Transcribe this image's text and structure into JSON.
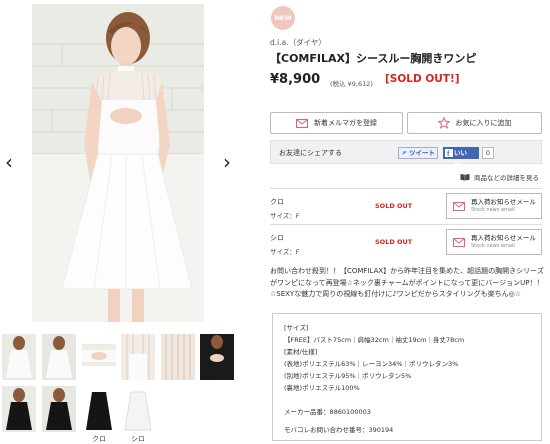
{
  "gallery": {
    "prev_arrow": "‹",
    "next_arrow": "›",
    "thumb_labels": [
      "クロ",
      "シロ"
    ]
  },
  "product": {
    "badge": "NEW",
    "brand": "d.i.a.（ダイヤ）",
    "title": "【COMFILAX】シースルー胸開きワンピ",
    "price": "¥8,900",
    "tax_price": "(税込 ¥9,612)",
    "sold_out_label": "[SOLD OUT!]"
  },
  "actions": {
    "newsletter_label": "新着メルマガを登録",
    "favorite_label": "お気に入りに追加"
  },
  "share": {
    "label": "お友達にシェアする",
    "tweet_label": "ツイート",
    "like_label": "いいね！",
    "like_count": "0"
  },
  "size_chart_link": "商品などの詳細を見る",
  "variants": [
    {
      "color": "クロ",
      "size": "サイズ：F",
      "status": "SOLD OUT",
      "restock_main": "再入荷お知らせメール",
      "restock_sub": "Stock news email"
    },
    {
      "color": "シロ",
      "size": "サイズ：F",
      "status": "SOLD OUT",
      "restock_main": "再入荷お知らせメール",
      "restock_sub": "Stock news email"
    }
  ],
  "description": "お問い合わせ殺到！！【COMFILAX】から昨年注目を集めた、超話題の胸開きシリーズがワンピになって再登場☆ネック裏チャームがポイントになって更にバージョンUP！！☆SEXYな魅力で周りの視線も釘付けに♪ワンピだからスタイリングも楽ちん◎☆",
  "specs": [
    "[サイズ]",
    "【FREE】バスト75cm｜肩幅32cm｜袖丈19cm｜身丈78cm",
    "[素材/仕様]",
    "(表地)ポリエステル63%｜レーヨン34%｜ポリウレタン3%",
    "(別地)ポリエステル95%｜ポリウレタン5%",
    "(裏地)ポリエステル100%",
    "メーカー品番：8860100003",
    "モバコレお問い合わせ番号：390194"
  ],
  "colors": {
    "sold_out": "#d8241d",
    "badge": "#f0c7bf",
    "accent_icon": "#e0607e"
  },
  "icons": [
    "envelope-icon",
    "star-icon",
    "book-icon",
    "twitter-bird-icon",
    "facebook-like-icon"
  ]
}
